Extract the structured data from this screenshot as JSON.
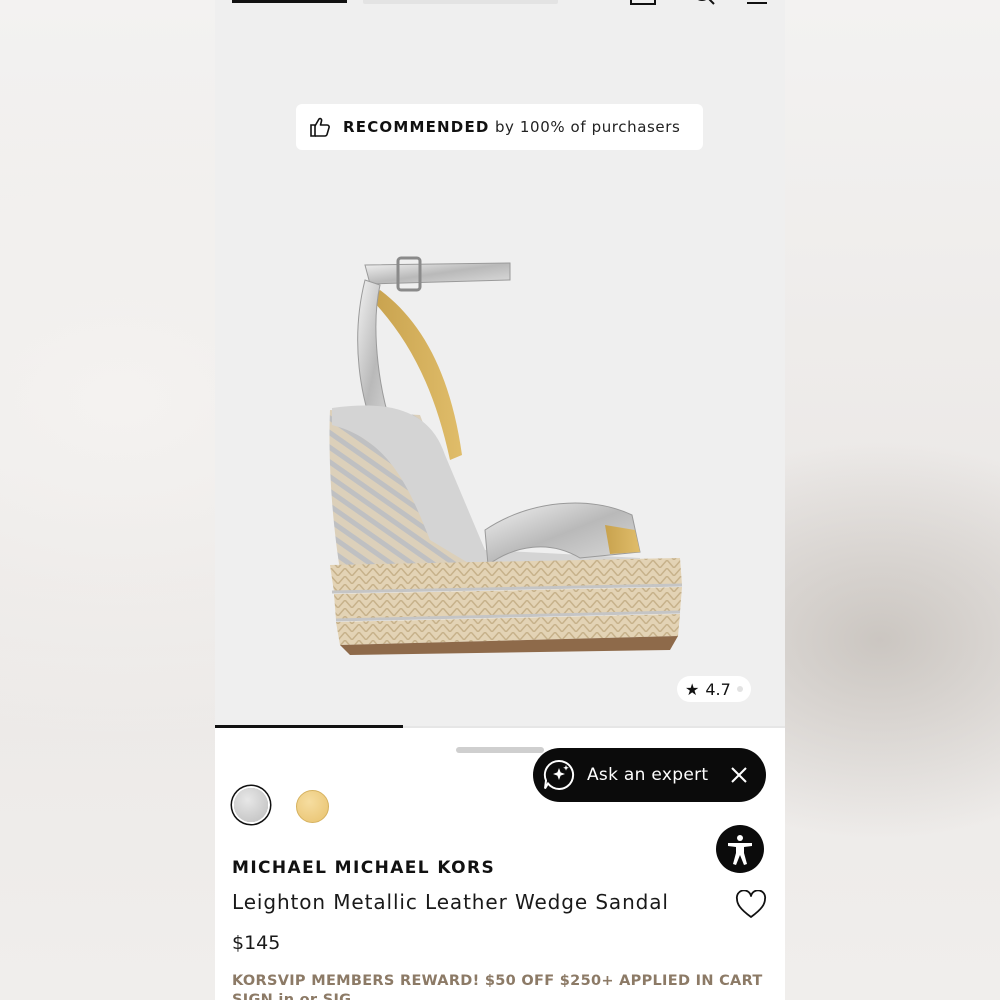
{
  "badge": {
    "strong": "RECOMMENDED",
    "rest": "by 100% of purchasers"
  },
  "rating": {
    "star": "★",
    "value": "4.7"
  },
  "gallery": {
    "progress_fraction": 0.33
  },
  "expert": {
    "label": "Ask an expert"
  },
  "swatches": [
    {
      "name": "Silver",
      "color": "#c9c9c9",
      "selected": true
    },
    {
      "name": "Gold",
      "color": "#efcf84",
      "selected": false
    }
  ],
  "product": {
    "brand": "MICHAEL MICHAEL KORS",
    "name": "Leighton Metallic Leather Wedge Sandal",
    "price": "$145"
  },
  "promo": {
    "line1": "KORSVIP MEMBERS REWARD! $50 OFF $250+ APPLIED IN CART",
    "line2": "SIGN in or SIG"
  },
  "icons": [
    "bag-icon",
    "search-icon",
    "menu-icon",
    "thumbs-up-icon",
    "star-icon",
    "ai-chat-icon",
    "close-icon",
    "accessibility-icon",
    "heart-icon"
  ]
}
